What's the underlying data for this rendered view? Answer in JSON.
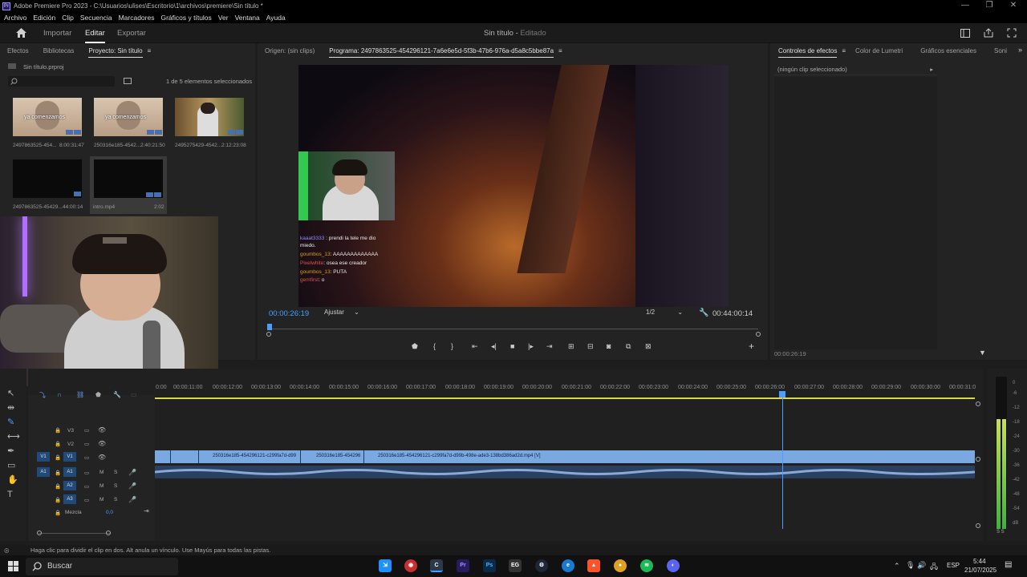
{
  "window": {
    "title": "Adobe Premiere Pro 2023 - C:\\Usuarios\\ulises\\Escritorio\\1\\archivos\\premiere\\Sin título *",
    "controls": [
      "—",
      "❐",
      "✕"
    ]
  },
  "menu": [
    "Archivo",
    "Edición",
    "Clip",
    "Secuencia",
    "Marcadores",
    "Gráficos y títulos",
    "Ver",
    "Ventana",
    "Ayuda"
  ],
  "header": {
    "tabs": [
      "Importar",
      "Editar",
      "Exportar"
    ],
    "active_tab": "Editar",
    "project_name": "Sin título",
    "project_state": "Editado"
  },
  "project_panel": {
    "tabs": [
      "Efectos",
      "Bibliotecas",
      "Proyecto: Sin título"
    ],
    "file": "Sin título.prproj",
    "selection_info": "1 de 5 elementos seleccionados",
    "items": [
      {
        "name": "2497863525-454...",
        "duration": "8:00:31:47",
        "overlay": "ya comenzamos"
      },
      {
        "name": "250316e185-4542...",
        "duration": "2:40:21:50",
        "overlay": "ya comenzamos"
      },
      {
        "name": "2495275429-4542...",
        "duration": "2:12:23:08",
        "overlay": ""
      },
      {
        "name": "2497863525-45429...",
        "duration": "44:00:14",
        "overlay": ""
      },
      {
        "name": "intro.mp4",
        "duration": "2:02",
        "overlay": ""
      }
    ]
  },
  "program_monitor": {
    "tabs": [
      "Origen: (sin clips)",
      "Programa: 2497863525-454296121-7a6e6e5d-5f3b-47b6-976a-d5a8c5bbe87a"
    ],
    "timecode": "00:00:26:19",
    "fit": "Ajustar",
    "resolution": "1/2",
    "duration": "00:44:00:14",
    "chat": [
      {
        "user": "kaaat3333",
        "msg": "prendi la tele me dio",
        "user_color": "#8f8fff"
      },
      {
        "user": "",
        "msg": "miedo",
        "user_color": "#ffffff"
      },
      {
        "user": "goumbos_13",
        "msg": "AAAAAAAAAAAAA",
        "user_color": "#d4a017"
      },
      {
        "user": "Pixelwhite",
        "msg": "osea ese creador",
        "user_color": "#e05050"
      },
      {
        "user": "goumbos_13",
        "msg": "PUTA",
        "user_color": "#d4a017"
      },
      {
        "user": "gemfirst",
        "msg": "o",
        "user_color": "#e05050"
      }
    ]
  },
  "effect_panel": {
    "tabs": [
      "Controles de efectos",
      "Color de Lumetri",
      "Gráficos esenciales",
      "Soni"
    ],
    "no_clip": "(ningún clip seleccionado)",
    "timecode": "00:00:26:19"
  },
  "timeline": {
    "ruler": [
      "0:00",
      "00:00:11:00",
      "00:00:12:00",
      "00:00:13:00",
      "00:00:14:00",
      "00:00:15:00",
      "00:00:16:00",
      "00:00:17:00",
      "00:00:18:00",
      "00:00:19:00",
      "00:00:20:00",
      "00:00:21:00",
      "00:00:22:00",
      "00:00:23:00",
      "00:00:24:00",
      "00:00:25:00",
      "00:00:26:00",
      "00:00:27:00",
      "00:00:28:00",
      "00:00:29:00",
      "00:00:30:00",
      "00:00:31:0"
    ],
    "video_tracks": [
      "V3",
      "V2",
      "V1"
    ],
    "audio_tracks": [
      "A1",
      "A2",
      "A3"
    ],
    "mix_label": "Mezcla",
    "mix_value": "0,0",
    "clips": [
      "250316e185-454296121-c299fa7d-d99",
      "250316e185-454296",
      "250316e185-454296121-c299fa7d-d99b-498e-ade3-138bd386ad2d.mp4 [V]"
    ]
  },
  "meters": {
    "scale": [
      "0",
      "-6",
      "-12",
      "-18",
      "-24",
      "-30",
      "-36",
      "-42",
      "-48",
      "-54",
      "dB"
    ],
    "solo": "S S",
    "level": 0.72
  },
  "status_text": "Haga clic para dividir el clip en dos. Alt anula un vínculo. Use Mayús para todas las pistas.",
  "taskbar": {
    "search": "Buscar",
    "lang": "ESP",
    "time": "5:44",
    "date": "21/07/2025"
  }
}
